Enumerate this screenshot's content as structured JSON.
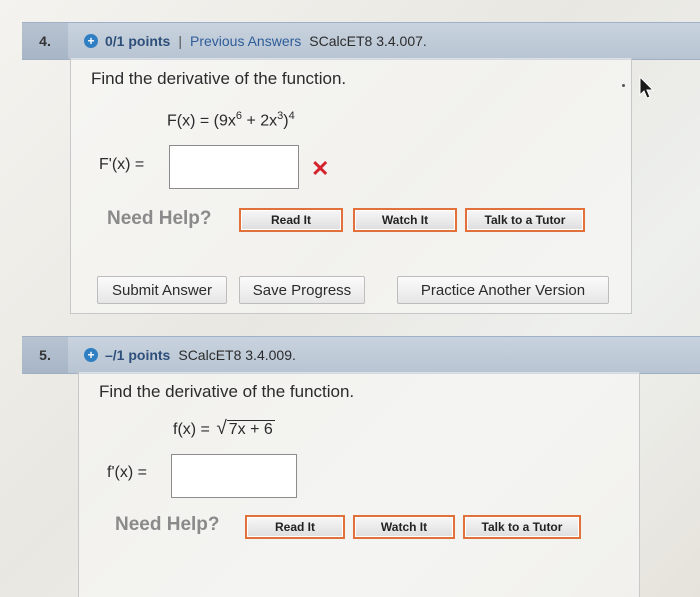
{
  "q4": {
    "number": "4.",
    "points": "0/1 points",
    "separator": "|",
    "previous_answers": "Previous Answers",
    "code": "SCalcET8 3.4.007.",
    "prompt": "Find the derivative of the function.",
    "formula": {
      "lhs": "F(x) = (9x",
      "exp1": "6",
      "mid": " + 2x",
      "exp2": "3",
      "close": ")",
      "exp3": "4"
    },
    "answer_label": "F'(x) =",
    "answer_value": "",
    "result_mark": "✕",
    "need_help": "Need Help?",
    "help_buttons": [
      "Read It",
      "Watch It",
      "Talk to a Tutor"
    ],
    "actions": [
      "Submit Answer",
      "Save Progress",
      "Practice Another Version"
    ]
  },
  "q5": {
    "number": "5.",
    "points": "–/1 points",
    "code": "SCalcET8 3.4.009.",
    "prompt": "Find the derivative of the function.",
    "formula": {
      "lhs": "f(x) =",
      "radical": "√",
      "radicand": "7x + 6"
    },
    "answer_label": "f'(x) =",
    "answer_value": "",
    "need_help": "Need Help?",
    "help_buttons": [
      "Read It",
      "Watch It",
      "Talk to a Tutor"
    ]
  },
  "icons": {
    "bullet": "plus-circle-icon",
    "wrong": "x-mark-icon",
    "cursor": "mouse-pointer-icon"
  },
  "colors": {
    "header_bg": "#c0cbd8",
    "link": "#2d5c99",
    "wrong": "#d4232e",
    "help_border": "#e0713a"
  }
}
